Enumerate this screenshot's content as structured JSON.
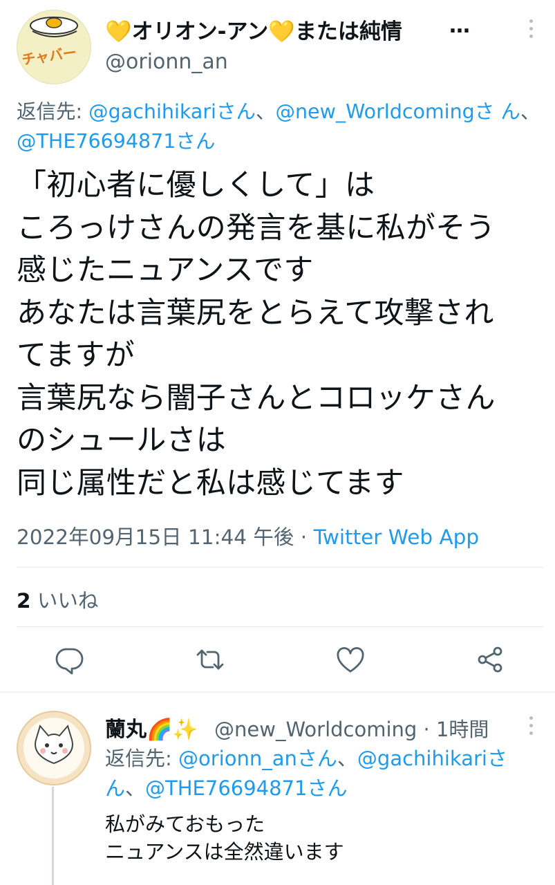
{
  "tweet": {
    "author_name": "💛オリオン-アン💛または純情",
    "more": "…",
    "author_handle": "@orionn_an",
    "avatar_text": "チャバー",
    "reply_label": "返信先: ",
    "reply_targets": [
      "@gachihikariさん",
      "@new_Worldcomingさ ん",
      "@THE76694871さん"
    ],
    "reply_sep": "、",
    "body": "「初心者に優しくして」は\nころっけさんの発言を基に私がそう\n感じたニュアンスです\nあなたは言葉尻をとらえて攻撃され\nてますが\n言葉尻なら闇子さんとコロッケさん\nのシュールさは\n同じ属性だと私は感じてます",
    "timestamp": "2022年09月15日 11:44 午後",
    "meta_sep": " · ",
    "source": "Twitter Web App",
    "likes_count": "2",
    "likes_label": " いいね"
  },
  "reply": {
    "author_name": "蘭丸🌈✨",
    "author_handle": "@new_Worldcoming · 1時間",
    "reply_label": "返信先: ",
    "reply_targets": [
      "@orionn_anさん",
      "@gachihikariさ ん",
      "@THE76694871さん"
    ],
    "reply_sep": "、",
    "body": "私がみておもった\nニュアンスは全然違います"
  },
  "colors": {
    "link": "#1d9bf0",
    "secondary": "#536471",
    "text": "#0f1419",
    "divider": "#e7e9ea"
  },
  "icons": [
    "reply-icon",
    "retweet-icon",
    "like-icon",
    "share-icon",
    "more-vertical-icon"
  ]
}
